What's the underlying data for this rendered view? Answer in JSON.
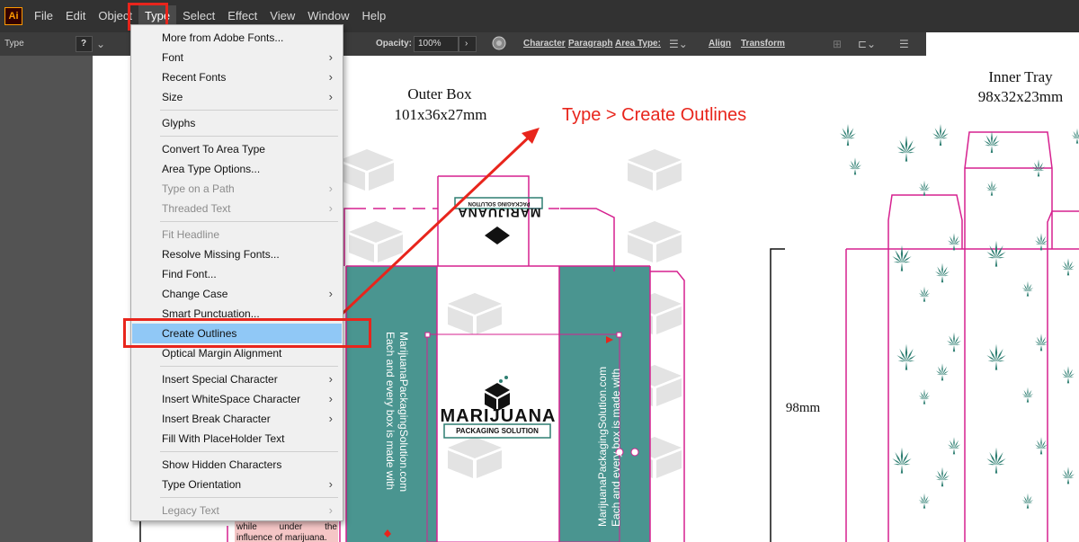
{
  "menubar": {
    "logo": "Ai",
    "items": [
      "File",
      "Edit",
      "Object",
      "Type",
      "Select",
      "Effect",
      "View",
      "Window",
      "Help"
    ],
    "active": "Type"
  },
  "controlbar": {
    "tool_label": "Type",
    "question_glyph": "?",
    "opacity_label": "Opacity:",
    "opacity_value": "100%",
    "character": "Character",
    "paragraph": "Paragraph",
    "area_type": "Area Type:",
    "align": "Align",
    "transform": "Transform"
  },
  "type_menu": {
    "items": [
      {
        "label": "More from Adobe Fonts...",
        "enabled": true,
        "submenu": false
      },
      {
        "label": "Font",
        "enabled": true,
        "submenu": true
      },
      {
        "label": "Recent Fonts",
        "enabled": true,
        "submenu": true
      },
      {
        "label": "Size",
        "enabled": true,
        "submenu": true
      },
      {
        "label": "Glyphs",
        "enabled": true,
        "submenu": false
      },
      {
        "label": "Convert To Area Type",
        "enabled": true,
        "submenu": false
      },
      {
        "label": "Area Type Options...",
        "enabled": true,
        "submenu": false
      },
      {
        "label": "Type on a Path",
        "enabled": false,
        "submenu": true
      },
      {
        "label": "Threaded Text",
        "enabled": false,
        "submenu": true
      },
      {
        "label": "Fit Headline",
        "enabled": false,
        "submenu": false
      },
      {
        "label": "Resolve Missing Fonts...",
        "enabled": true,
        "submenu": false
      },
      {
        "label": "Find Font...",
        "enabled": true,
        "submenu": false
      },
      {
        "label": "Change Case",
        "enabled": true,
        "submenu": true
      },
      {
        "label": "Smart Punctuation...",
        "enabled": true,
        "submenu": false
      },
      {
        "label": "Create Outlines",
        "enabled": true,
        "submenu": false,
        "highlighted": true
      },
      {
        "label": "Optical Margin Alignment",
        "enabled": true,
        "submenu": false
      },
      {
        "label": "Insert Special Character",
        "enabled": true,
        "submenu": true
      },
      {
        "label": "Insert WhiteSpace Character",
        "enabled": true,
        "submenu": true
      },
      {
        "label": "Insert Break Character",
        "enabled": true,
        "submenu": true
      },
      {
        "label": "Fill With PlaceHolder Text",
        "enabled": true,
        "submenu": false
      },
      {
        "label": "Show Hidden Characters",
        "enabled": true,
        "submenu": false
      },
      {
        "label": "Type Orientation",
        "enabled": true,
        "submenu": true
      },
      {
        "label": "Legacy Text",
        "enabled": false,
        "submenu": true
      }
    ]
  },
  "annotation": "Type > Create Outlines",
  "artboard": {
    "outer_box_title": "Outer Box",
    "outer_box_dims": "101x36x27mm",
    "inner_tray_title": "Inner Tray",
    "inner_tray_dims": "98x32x23mm",
    "height_label": "98mm",
    "brand": "MARIJUANA",
    "brand_sub": "PACKAGING SOLUTION",
    "vertical_text_1": "MarijuanaPackagingSolution.com",
    "vertical_text_2": "Each and every box is made with",
    "pink_text_1": "while under the",
    "pink_text_2": "influence of marijuana."
  },
  "colors": {
    "teal": "#4a9590",
    "leaf": "#2f7f72",
    "magenta": "#d6218f",
    "red_annotation": "#e8251c",
    "menu_highlight": "#90c8f6"
  }
}
